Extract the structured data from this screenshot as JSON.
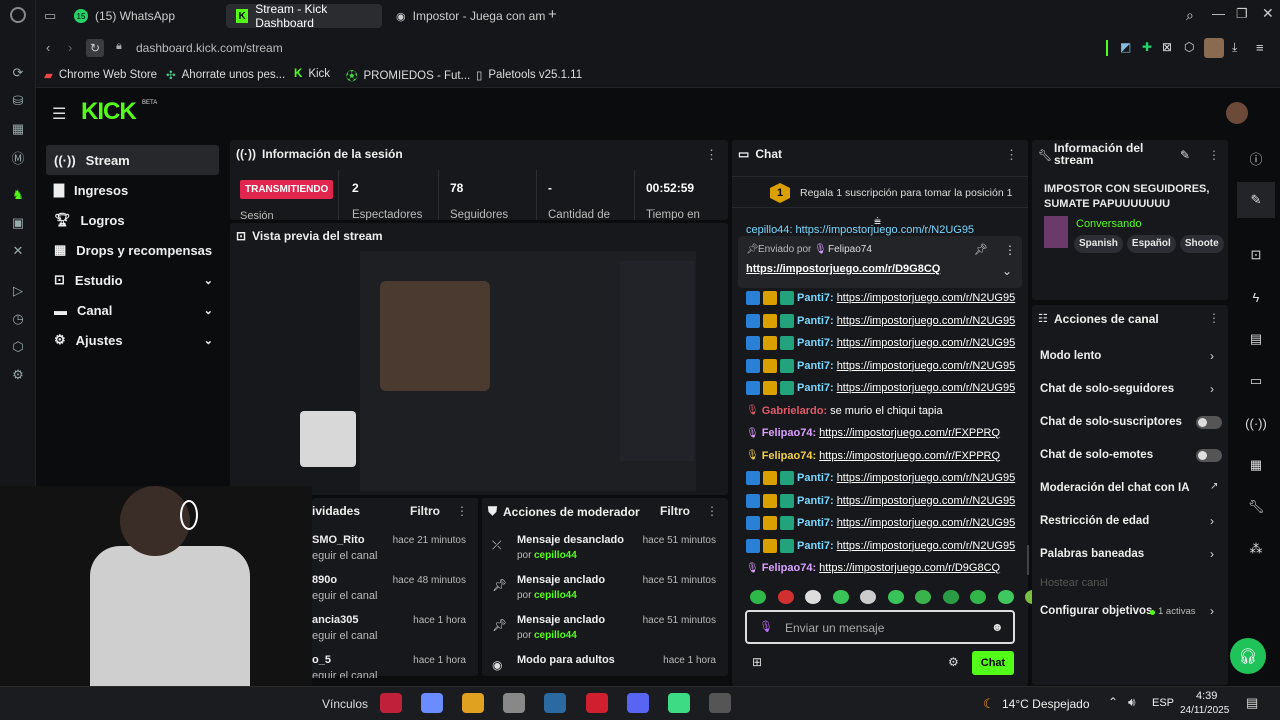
{
  "tabs": [
    {
      "label": "(15) WhatsApp",
      "badge": "15"
    },
    {
      "label": "Stream - Kick Dashboard"
    },
    {
      "label": "Impostor - Juega con ami"
    }
  ],
  "address": {
    "url": "dashboard.kick.com/stream"
  },
  "bookmarks": [
    "Chrome Web Store",
    "Ahorrate unos pes...",
    "Kick",
    "PROMIEDOS - Fut...",
    "Paletools v25.1.11"
  ],
  "logo": "KICK",
  "logo_badge": "BETA",
  "nav": [
    {
      "label": "Stream"
    },
    {
      "label": "Ingresos"
    },
    {
      "label": "Logros"
    },
    {
      "label": "Drops y recompensas"
    },
    {
      "label": "Estudio"
    },
    {
      "label": "Canal"
    },
    {
      "label": "Ajustes"
    }
  ],
  "session": {
    "title": "Información de la sesión",
    "status": "TRANSMITIENDO",
    "status_sub": "Sesión",
    "stats": [
      {
        "value": "2",
        "label": "Espectadores"
      },
      {
        "value": "78",
        "label": "Seguidores"
      },
      {
        "value": "-",
        "label": "Cantidad de"
      },
      {
        "value": "00:52:59",
        "label": "Tiempo en"
      }
    ]
  },
  "preview": {
    "title": "Vista previa del stream"
  },
  "activity": {
    "title": "ividades",
    "filter": "Filtro",
    "rows": [
      {
        "name": "SMO_Rito",
        "sub": "eguir el canal",
        "time": "hace 21 minutos"
      },
      {
        "name": "890o",
        "sub": "eguir el canal",
        "time": "hace 48 minutos"
      },
      {
        "name": "ancia305",
        "sub": "eguir el canal",
        "time": "hace 1 hora"
      },
      {
        "name": "o_5",
        "sub": "eguir el canal",
        "time": "hace 1 hora"
      }
    ]
  },
  "modactions": {
    "title": "Acciones de moderador",
    "filter": "Filtro",
    "rows": [
      {
        "action": "Mensaje desanclado",
        "by": "por",
        "user": "cepillo44",
        "time": "hace 51 minutos"
      },
      {
        "action": "Mensaje anclado",
        "by": "por",
        "user": "cepillo44",
        "time": "hace 51 minutos"
      },
      {
        "action": "Mensaje anclado",
        "by": "por",
        "user": "cepillo44",
        "time": "hace 51 minutos"
      },
      {
        "action": "Modo para adultos",
        "by": "",
        "user": "",
        "time": "hace 1 hora"
      }
    ]
  },
  "chat": {
    "title": "Chat",
    "gift_rank": "1",
    "gift_text": "Regala 1 suscripción para tomar la posición 1",
    "pinned_label": "Enviado por",
    "pinned_user": "Felipao74",
    "pinned_link": "https://impostorjuego.com/r/D9G8CQ",
    "partial_top": "cepillo44: https://impostorjuego.com/r/N2UG95",
    "messages": [
      {
        "user": "Panti7:",
        "text": "https://impostorjuego.com/r/N2UG95",
        "color": "#7ad7ff",
        "badges": 3
      },
      {
        "user": "Panti7:",
        "text": "https://impostorjuego.com/r/N2UG95",
        "color": "#7ad7ff",
        "badges": 3
      },
      {
        "user": "Panti7:",
        "text": "https://impostorjuego.com/r/N2UG95",
        "color": "#7ad7ff",
        "badges": 3
      },
      {
        "user": "Panti7:",
        "text": "https://impostorjuego.com/r/N2UG95",
        "color": "#7ad7ff",
        "badges": 3
      },
      {
        "user": "Panti7:",
        "text": "https://impostorjuego.com/r/N2UG95",
        "color": "#7ad7ff",
        "badges": 3
      },
      {
        "user": "Gabrielardo:",
        "text": "se murio el chiqui tapia",
        "color": "#e05a6a",
        "badges": 1
      },
      {
        "user": "Felipao74:",
        "text": "https://impostorjuego.com/r/FXPPRQ",
        "color": "#d9a0ff",
        "badges": 1
      },
      {
        "user": "Felipao74:",
        "text": "https://impostorjuego.com/r/FXPPRQ",
        "color": "#f2d04a",
        "badges": 1
      },
      {
        "user": "Panti7:",
        "text": "https://impostorjuego.com/r/N2UG95",
        "color": "#7ad7ff",
        "badges": 3
      },
      {
        "user": "Panti7:",
        "text": "https://impostorjuego.com/r/N2UG95",
        "color": "#7ad7ff",
        "badges": 3
      },
      {
        "user": "Panti7:",
        "text": "https://impostorjuego.com/r/N2UG95",
        "color": "#7ad7ff",
        "badges": 3
      },
      {
        "user": "Panti7:",
        "text": "https://impostorjuego.com/r/N2UG95",
        "color": "#7ad7ff",
        "badges": 3
      },
      {
        "user": "Felipao74:",
        "text": "https://impostorjuego.com/r/D9G8CQ",
        "color": "#d9a0ff",
        "badges": 1
      }
    ],
    "input_placeholder": "Enviar un mensaje",
    "send_label": "Chat"
  },
  "streaminfo": {
    "title": "Información del stream",
    "stream_title": "IMPOSTOR CON SEGUIDORES, SUMATE PAPUUUUUUU",
    "category": "Conversando",
    "tags": [
      "Spanish",
      "Español",
      "Shoote"
    ]
  },
  "channel_actions": {
    "title": "Acciones de canal",
    "items": [
      {
        "label": "Modo lento",
        "kind": "chevron"
      },
      {
        "label": "Chat de solo-seguidores",
        "kind": "chevron"
      },
      {
        "label": "Chat de solo-suscriptores",
        "kind": "toggle"
      },
      {
        "label": "Chat de solo-emotes",
        "kind": "toggle"
      },
      {
        "label": "Moderación del chat con IA",
        "kind": "external"
      },
      {
        "label": "Restricción de edad",
        "kind": "chevron"
      },
      {
        "label": "Palabras baneadas",
        "kind": "chevron"
      },
      {
        "label": "Hostear canal",
        "kind": "disabled"
      },
      {
        "label": "Configurar objetivos",
        "kind": "chevron",
        "extra": "1 activas"
      }
    ]
  },
  "taskbar": {
    "links": "Vínculos",
    "weather": "14°C Despejado",
    "lang": "ESP",
    "time": "4:39",
    "date": "24/11/2025"
  },
  "colors": {
    "accent": "#53fc18",
    "live": "#e0264e",
    "panel": "#17181b"
  }
}
